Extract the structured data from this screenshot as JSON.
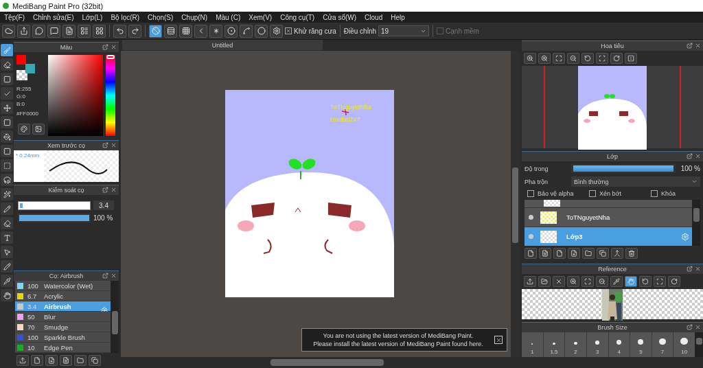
{
  "window": {
    "title": "MediBang Paint Pro (32bit)"
  },
  "menu": [
    "Tệp(F)",
    "Chỉnh sửa(E)",
    "Lớp(L)",
    "Bộ lọc(R)",
    "Chọn(S)",
    "Chụp(N)",
    "Màu (C)",
    "Xem(V)",
    "Công cụ(T)",
    "Cửa sổ(W)",
    "Cloud",
    "Help"
  ],
  "snap_tools": [
    {
      "selected": true
    },
    {
      "selected": false
    },
    {
      "selected": false
    },
    {
      "selected": false
    },
    {
      "selected": false
    },
    {
      "selected": false
    },
    {
      "selected": false
    },
    {
      "selected": false
    },
    {
      "selected": false
    }
  ],
  "toolbar": {
    "antialias": {
      "label": "Khử răng cưa",
      "checked": true
    },
    "correction": {
      "label": "Điều chỉnh",
      "value": "19"
    },
    "soft_edge": {
      "label": "Cạnh mềm",
      "checked": false,
      "disabled": true
    }
  },
  "tools": [
    {
      "selected": true
    },
    {
      "selected": false
    },
    {
      "selected": false
    },
    {
      "selected": false
    },
    {
      "selected": false
    },
    {
      "selected": false
    },
    {
      "selected": false
    },
    {
      "selected": false
    },
    {
      "selected": false
    },
    {
      "selected": false
    },
    {
      "selected": false
    },
    {
      "selected": false
    },
    {
      "selected": false
    },
    {
      "selected": false
    },
    {
      "selected": false
    },
    {
      "selected": false
    },
    {
      "selected": false
    },
    {
      "selected": false
    }
  ],
  "color_panel": {
    "title": "Màu",
    "swatches": [
      {
        "color": "#ff0000"
      },
      {
        "color": "#3aa7b0"
      }
    ],
    "hue": {
      "level": 0
    },
    "r": "R:255",
    "g": "G:0",
    "b": "B:0",
    "hex": "#FF0000"
  },
  "brush_preview": {
    "title": "Xem trước cọ",
    "size": "* 0.24mm"
  },
  "brush_control": {
    "title": "Kiểm soát cọ",
    "size": {
      "level": 0.04,
      "value": "3.4"
    },
    "opacity": {
      "level": 1,
      "value": "100 %"
    }
  },
  "brush_list": {
    "title": "Cọ: Airbrush",
    "items": [
      {
        "size": "100",
        "name": "Watercolor (Wet)",
        "color": "#7fd8f0",
        "selected": false
      },
      {
        "size": "6.7",
        "name": "Acrylic",
        "color": "#e8d600",
        "selected": false
      },
      {
        "size": "3.4",
        "name": "Airbrush",
        "color": "#c8c8c8",
        "selected": true
      },
      {
        "size": "50",
        "name": "Blur",
        "color": "#f0a0f0",
        "selected": false
      },
      {
        "size": "70",
        "name": "Smudge",
        "color": "#f8d8c0",
        "selected": false
      },
      {
        "size": "100",
        "name": "Sparkle Brush",
        "color": "#3050e0",
        "selected": false
      },
      {
        "size": "10",
        "name": "Edge Pen",
        "color": "#10b020",
        "selected": false
      }
    ]
  },
  "canvas": {
    "tab": "Untitled",
    "texts": [
      "ToTNguyetNha",
      "Hoidap247"
    ]
  },
  "notification": {
    "lines": [
      "You are not using the latest version of MediBang Paint.",
      "Please install the latest version of MediBang Paint found here."
    ]
  },
  "navigator": {
    "title": "Hoa tiêu"
  },
  "layers": {
    "title": "Lớp",
    "opacity": {
      "label": "Độ trong",
      "level": 1,
      "value": "100 %"
    },
    "blend_label": "Pha trộn",
    "blend_value": "Bình thường",
    "checks": [
      {
        "label": "Bảo vệ alpha",
        "checked": false
      },
      {
        "label": "Xén bớt",
        "checked": false
      },
      {
        "label": "Khóa",
        "checked": false
      }
    ],
    "items": [
      {
        "name": "ToTNguyetNha",
        "selected": false
      },
      {
        "name": "Lớp3",
        "selected": true
      }
    ]
  },
  "reference": {
    "title": "Reference"
  },
  "brush_size": {
    "title": "Brush Size",
    "sizes": [
      "1",
      "1.5",
      "2",
      "3",
      "4",
      "5",
      "7",
      "10"
    ]
  }
}
